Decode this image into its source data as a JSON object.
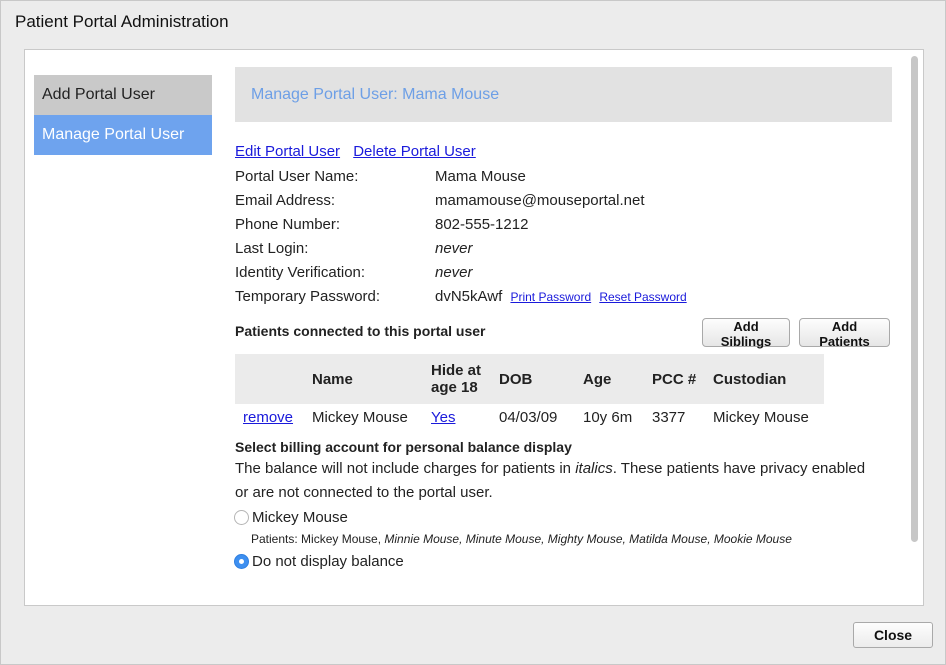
{
  "dialog": {
    "title": "Patient Portal Administration",
    "close_label": "Close"
  },
  "sidebar": {
    "items": [
      {
        "label": "Add Portal User"
      },
      {
        "label": "Manage Portal User"
      }
    ]
  },
  "panel": {
    "header": "Manage Portal User: Mama Mouse",
    "edit_link": "Edit Portal User",
    "delete_link": "Delete Portal User"
  },
  "user_info": {
    "name_label": "Portal User Name:",
    "name_value": "Mama Mouse",
    "email_label": "Email Address:",
    "email_value": "mamamouse@mouseportal.net",
    "phone_label": "Phone Number:",
    "phone_value": "802-555-1212",
    "login_label": "Last Login:",
    "login_value": "never",
    "identity_label": "Identity Verification:",
    "identity_value": "never",
    "temp_pw_label": "Temporary Password:",
    "temp_pw_value": "dvN5kAwf",
    "print_pw_link": "Print Password",
    "reset_pw_link": "Reset Password"
  },
  "patients": {
    "title": "Patients connected to this portal user",
    "add_siblings": "Add Siblings",
    "add_patients": "Add Patients",
    "columns": {
      "name": "Name",
      "hide_line1": "Hide at",
      "hide_line2": "age 18",
      "dob": "DOB",
      "age": "Age",
      "pcc": "PCC #",
      "custodian": "Custodian"
    },
    "rows": [
      {
        "action": "remove",
        "name": "Mickey Mouse",
        "hide": "Yes",
        "dob": "04/03/09",
        "age": "10y 6m",
        "pcc": "3377",
        "custodian": "Mickey Mouse"
      }
    ]
  },
  "billing": {
    "title": "Select billing account for personal balance display",
    "desc_before": "The balance will not include charges for patients in ",
    "desc_italic": "italics",
    "desc_after": ". These patients have privacy enabled or are not connected to the portal user.",
    "option1_label": "Mickey Mouse",
    "option1_patients_prefix": "Patients: Mickey Mouse, ",
    "option1_patients_italic": "Minnie Mouse, Minute Mouse, Mighty Mouse, Matilda Mouse, Mookie Mouse",
    "option2_label": "Do not display balance",
    "selected": "option2"
  },
  "colors": {
    "accent": "#6ea3ee",
    "link": "#1a1adb",
    "header_text": "#6d9fe6"
  }
}
